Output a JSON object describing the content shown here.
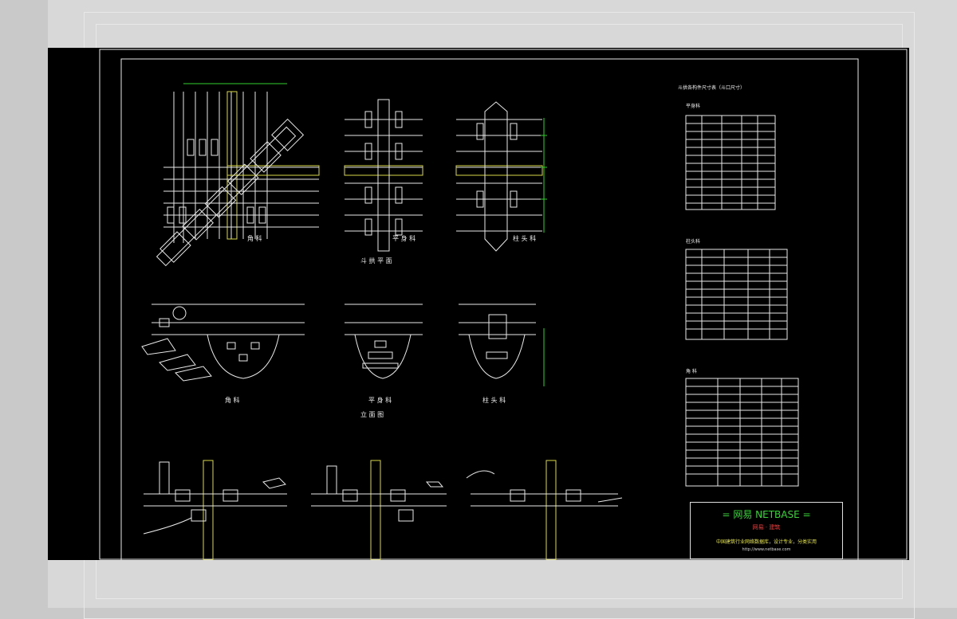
{
  "logo": {
    "line1": "= 网易 NETBASE =",
    "line2": "网易 · 建筑",
    "line3": "中国建筑行业网络数据库，设计专业，分类实用",
    "line4": "http://www.netbase.com"
  },
  "drawings": {
    "top_left_caption": "角 科",
    "top_mid_caption": "平 身 科",
    "top_right_caption": "柱 头 科",
    "plan_title": "斗 拱 平 面",
    "mid_left_caption": "角 科",
    "mid_mid_caption": "平 身 科",
    "mid_right_caption": "柱 头 科",
    "elev_title": "立 面 图"
  },
  "tables": {
    "main_title": "斗拱各构件尺寸表（斗口尺寸）",
    "table1_title": "平身科",
    "table2_title": "柱头科",
    "table3_title": "角 科"
  },
  "colors": {
    "drawing_lines": "#e8e8e8",
    "dimension_lines": "#2fd02f",
    "hatch": "#d8d84a",
    "logo_green": "#36d236",
    "logo_red": "#e04040",
    "logo_yellow": "#e6e64a"
  }
}
